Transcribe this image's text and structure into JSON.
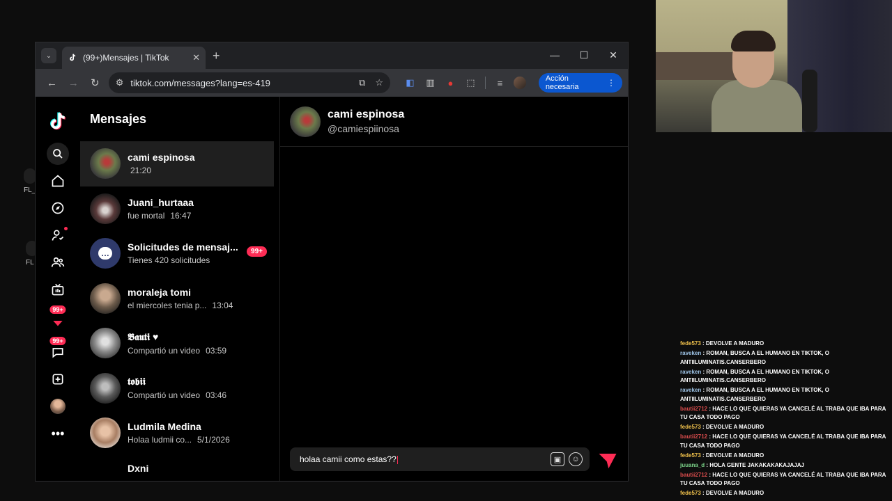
{
  "window": {
    "tab_title": "(99+)Mensajes | TikTok",
    "url": "tiktok.com/messages?lang=es-419",
    "action_button": "Acción necesaria"
  },
  "sidebar_nav": {
    "badge_primary": "99+",
    "badge_secondary": "99+"
  },
  "messages": {
    "heading": "Mensajes",
    "conversations": [
      {
        "name": "cami espinosa",
        "preview": "",
        "time": "21:20"
      },
      {
        "name": "Juani_hurtaaa",
        "preview": "fue mortal",
        "time": "16:47"
      },
      {
        "name": "Solicitudes de mensaj...",
        "preview": "Tienes 420 solicitudes",
        "time": "",
        "badge": "99+"
      },
      {
        "name": "moraleja tomi",
        "preview": "el miercoles tenia p...",
        "time": "13:04"
      },
      {
        "name": "𝕭𝖆𝖚𝖙𝖎 ♥",
        "preview": "Compartió un video",
        "time": "03:59"
      },
      {
        "name": "𝖙𝖔𝖇𝖎𝖎",
        "preview": "Compartió un video",
        "time": "03:46"
      },
      {
        "name": "Ludmila Medina",
        "preview": "Holaa ludmii co...",
        "time": "5/1/2026"
      },
      {
        "name": "Dxni",
        "preview": "",
        "time": ""
      }
    ]
  },
  "chat": {
    "name": "cami espinosa",
    "handle": "@camiespiinosa",
    "draft": "holaa camii como estas??"
  },
  "desktop_icons": [
    "FL_",
    "FL"
  ],
  "stream_chat": [
    {
      "user": "fede573",
      "text": "DEVOLVE A MADURO",
      "color": "#f0c14b"
    },
    {
      "user": "raveken",
      "text": "ROMAN, BUSCA A EL HUMANO EN TIKTOK, O ANTIILUMINATIS.CANSERBERO",
      "color": "#9fc5e8"
    },
    {
      "user": "raveken",
      "text": "ROMAN, BUSCA A EL HUMANO EN TIKTOK, O ANTIILUMINATIS.CANSERBERO",
      "color": "#9fc5e8"
    },
    {
      "user": "raveken",
      "text": "ROMAN, BUSCA A EL HUMANO EN TIKTOK, O ANTIILUMINATIS.CANSERBERO",
      "color": "#9fc5e8"
    },
    {
      "user": "bautii2712",
      "text": "HACE LO QUE QUIERAS YA CANCELÉ AL TRABA QUE IBA PARA TU CASA TODO PAGO",
      "color": "#d94c4c"
    },
    {
      "user": "fede573",
      "text": "DEVOLVE A MADURO",
      "color": "#f0c14b"
    },
    {
      "user": "bautii2712",
      "text": "HACE LO QUE QUIERAS YA CANCELÉ AL TRABA QUE IBA PARA TU CASA TODO PAGO",
      "color": "#d94c4c"
    },
    {
      "user": "fede573",
      "text": "DEVOLVE A MADURO",
      "color": "#f0c14b"
    },
    {
      "user": "juuana_d",
      "text": "HOLA GENTE JAKAKAKAKAJAJAJ",
      "color": "#7bd389"
    },
    {
      "user": "bautii2712",
      "text": "HACE LO QUE QUIERAS YA CANCELÉ AL TRABA QUE IBA PARA TU CASA TODO PAGO",
      "color": "#d94c4c"
    },
    {
      "user": "fede573",
      "text": "DEVOLVE A MADURO",
      "color": "#f0c14b"
    }
  ]
}
